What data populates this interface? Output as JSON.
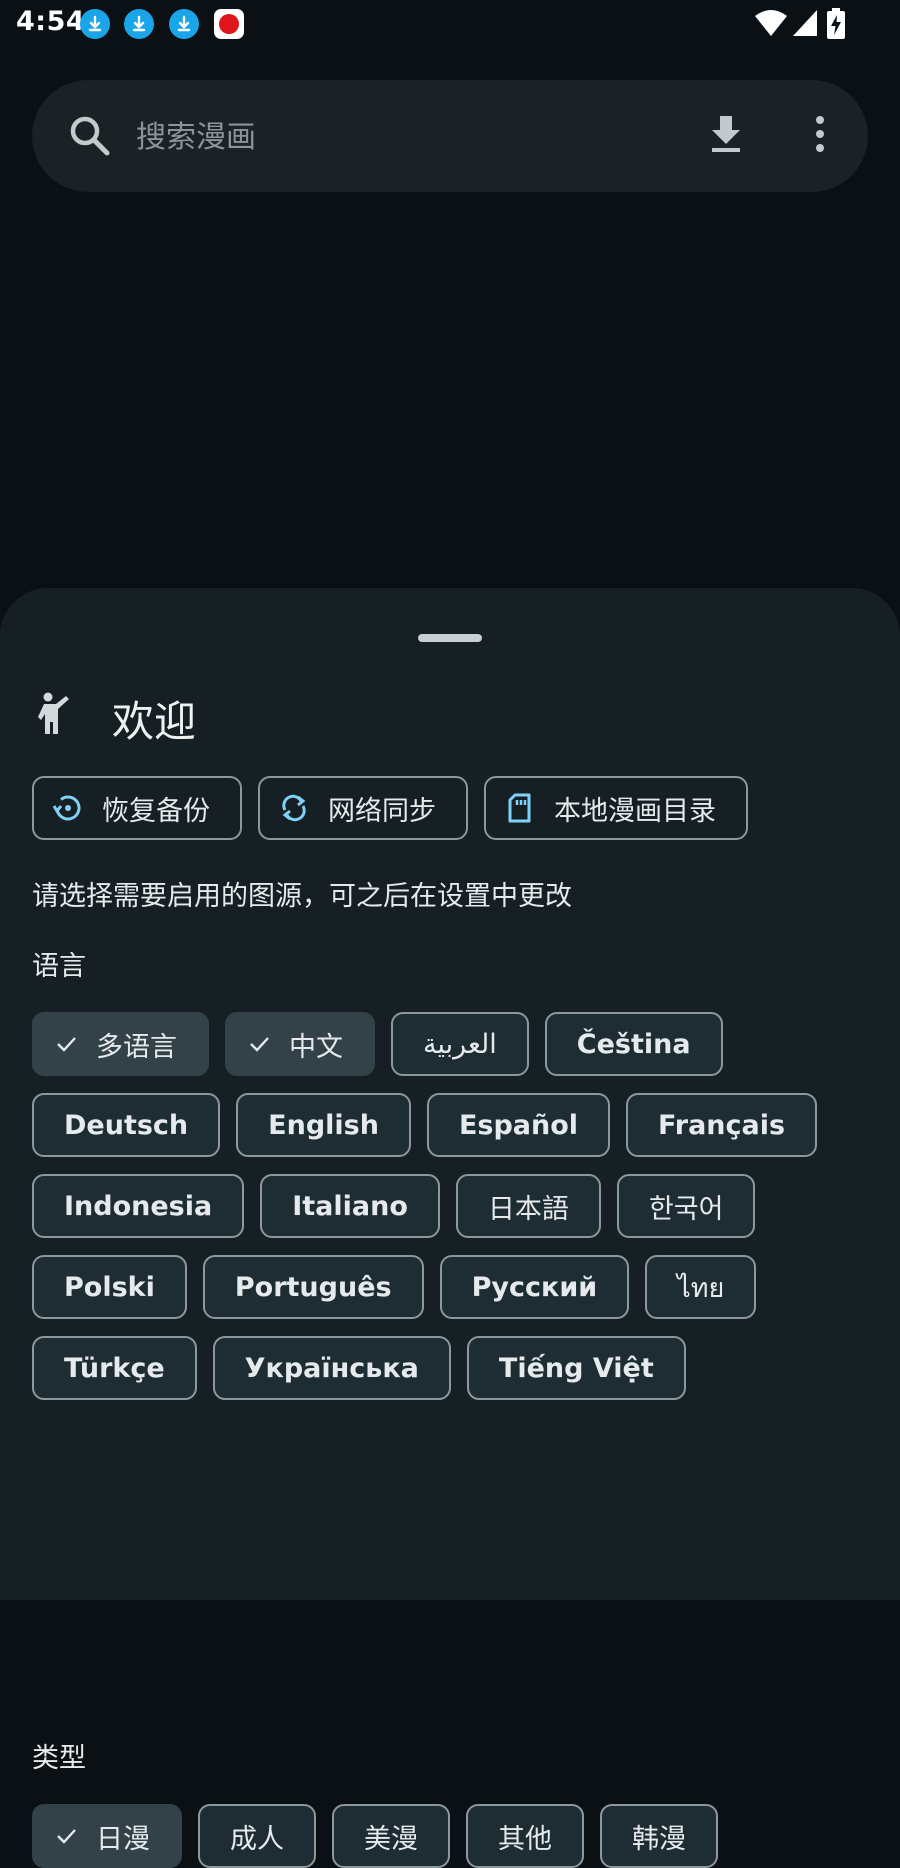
{
  "status_bar": {
    "time": "4:54",
    "notification_icons": [
      "download-icon",
      "download-icon",
      "download-icon",
      "app-icon"
    ],
    "system_icons": [
      "wifi-icon",
      "signal-icon",
      "battery-charging-icon"
    ]
  },
  "search": {
    "placeholder": "搜索漫画",
    "value": "",
    "icons": [
      "search-icon",
      "download-icon",
      "more-vert-icon"
    ]
  },
  "sheet": {
    "title": "欢迎",
    "title_icon": "person-waving-icon",
    "actions": [
      {
        "label": "恢复备份",
        "icon": "restore-icon"
      },
      {
        "label": "网络同步",
        "icon": "sync-icon"
      },
      {
        "label": "本地漫画目录",
        "icon": "sd-card-icon"
      }
    ],
    "hint": "请选择需要启用的图源，可之后在设置中更改",
    "language_label": "语言",
    "languages": [
      {
        "label": "多语言",
        "selected": true
      },
      {
        "label": "中文",
        "selected": true
      },
      {
        "label": "العربية",
        "selected": false
      },
      {
        "label": "Čeština",
        "selected": false
      },
      {
        "label": "Deutsch",
        "selected": false
      },
      {
        "label": "English",
        "selected": false
      },
      {
        "label": "Español",
        "selected": false
      },
      {
        "label": "Français",
        "selected": false
      },
      {
        "label": "Indonesia",
        "selected": false
      },
      {
        "label": "Italiano",
        "selected": false
      },
      {
        "label": "日本語",
        "selected": false
      },
      {
        "label": "한국어",
        "selected": false
      },
      {
        "label": "Polski",
        "selected": false
      },
      {
        "label": "Português",
        "selected": false
      },
      {
        "label": "Русский",
        "selected": false
      },
      {
        "label": "ไทย",
        "selected": false
      },
      {
        "label": "Türkçe",
        "selected": false
      },
      {
        "label": "Українська",
        "selected": false
      },
      {
        "label": "Tiếng Việt",
        "selected": false
      }
    ],
    "type_label": "类型",
    "types": [
      {
        "label": "日漫",
        "selected": true
      },
      {
        "label": "成人",
        "selected": false
      },
      {
        "label": "美漫",
        "selected": false
      },
      {
        "label": "其他",
        "selected": false
      },
      {
        "label": "韩漫",
        "selected": false
      }
    ]
  },
  "colors": {
    "background": "#0a1014",
    "sheet": "#162024",
    "chip": "#1e2d33",
    "chip_selected": "#334249",
    "accent_icon": "#7fd1f5",
    "notification": "#1aa5e8"
  }
}
